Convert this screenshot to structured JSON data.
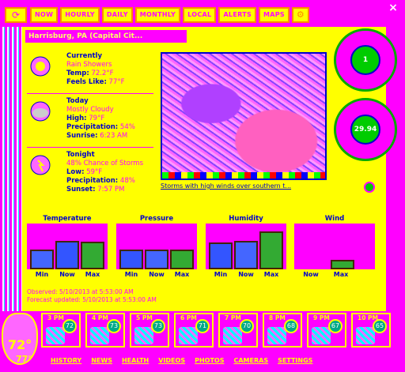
{
  "window": {
    "close": "×"
  },
  "nav": {
    "refresh_icon": "refresh-icon",
    "tabs": [
      "NOW",
      "HOURLY",
      "DAILY",
      "MONTHLY",
      "LOCAL",
      "ALERTS",
      "MAPS"
    ],
    "settings_icon": "gear-icon"
  },
  "location": "Harrisburg, PA (Capital Cit...",
  "current": {
    "head": "Currently",
    "cond": "Rain Showers",
    "temp_k": "Temp:",
    "temp_v": "72.2°F",
    "feels_k": "Feels Like:",
    "feels_v": "77°F"
  },
  "today": {
    "head": "Today",
    "cond": "Mostly Cloudy",
    "high_k": "High:",
    "high_v": "79°F",
    "precip_k": "Precipitation:",
    "precip_v": "54%",
    "sunrise_k": "Sunrise:",
    "sunrise_v": "6:23 AM"
  },
  "tonight": {
    "head": "Tonight",
    "cond": "48% Chance of Storms",
    "low_k": "Low:",
    "low_v": "59°F",
    "precip_k": "Precipitation:",
    "precip_v": "48%",
    "sunset_k": "Sunset:",
    "sunset_v": "7:57 PM"
  },
  "radar": {
    "caption": "Storms with high winds over southern t..."
  },
  "gauges": {
    "wind": "1",
    "pressure": "29.94"
  },
  "mini": [
    {
      "label": "Temperature",
      "caps": [
        "Min",
        "Now",
        "Max"
      ],
      "levels": [
        0.45,
        0.65,
        0.62
      ],
      "colors": [
        "#4466ff",
        "#3355ff",
        "#33aa33"
      ]
    },
    {
      "label": "Pressure",
      "caps": [
        "Min",
        "Now",
        "Max"
      ],
      "levels": [
        0.45,
        0.45,
        0.45
      ],
      "colors": [
        "#3355ff",
        "#4466ff",
        "#33aa33"
      ]
    },
    {
      "label": "Humidity",
      "caps": [
        "Min",
        "Now",
        "Max"
      ],
      "levels": [
        0.6,
        0.65,
        0.85
      ],
      "colors": [
        "#3355ff",
        "#4466ff",
        "#33aa33"
      ]
    },
    {
      "label": "Wind",
      "caps": [
        "Now",
        "Max"
      ],
      "levels": [
        0.0,
        0.22
      ],
      "colors": [
        "#3355ff",
        "#33aa33"
      ]
    }
  ],
  "updated": {
    "line1": "Observed: 5/10/2013 at 5:53:00 AM",
    "line2": "Forecast updated: 5/10/2013 at 5:53:00 AM"
  },
  "bubble": {
    "now": "72°",
    "feels": "77°"
  },
  "hourly": [
    {
      "time": "3 PM",
      "temp": "72"
    },
    {
      "time": "4 PM",
      "temp": "73"
    },
    {
      "time": "5 PM",
      "temp": "73"
    },
    {
      "time": "6 PM",
      "temp": "71"
    },
    {
      "time": "7 PM",
      "temp": "70"
    },
    {
      "time": "8 PM",
      "temp": "68"
    },
    {
      "time": "9 PM",
      "temp": "67"
    },
    {
      "time": "10 PM",
      "temp": "65"
    }
  ],
  "footer": [
    "HISTORY",
    "NEWS",
    "HEALTH",
    "VIDEOS",
    "PHOTOS",
    "CAMERAS",
    "SETTINGS"
  ]
}
